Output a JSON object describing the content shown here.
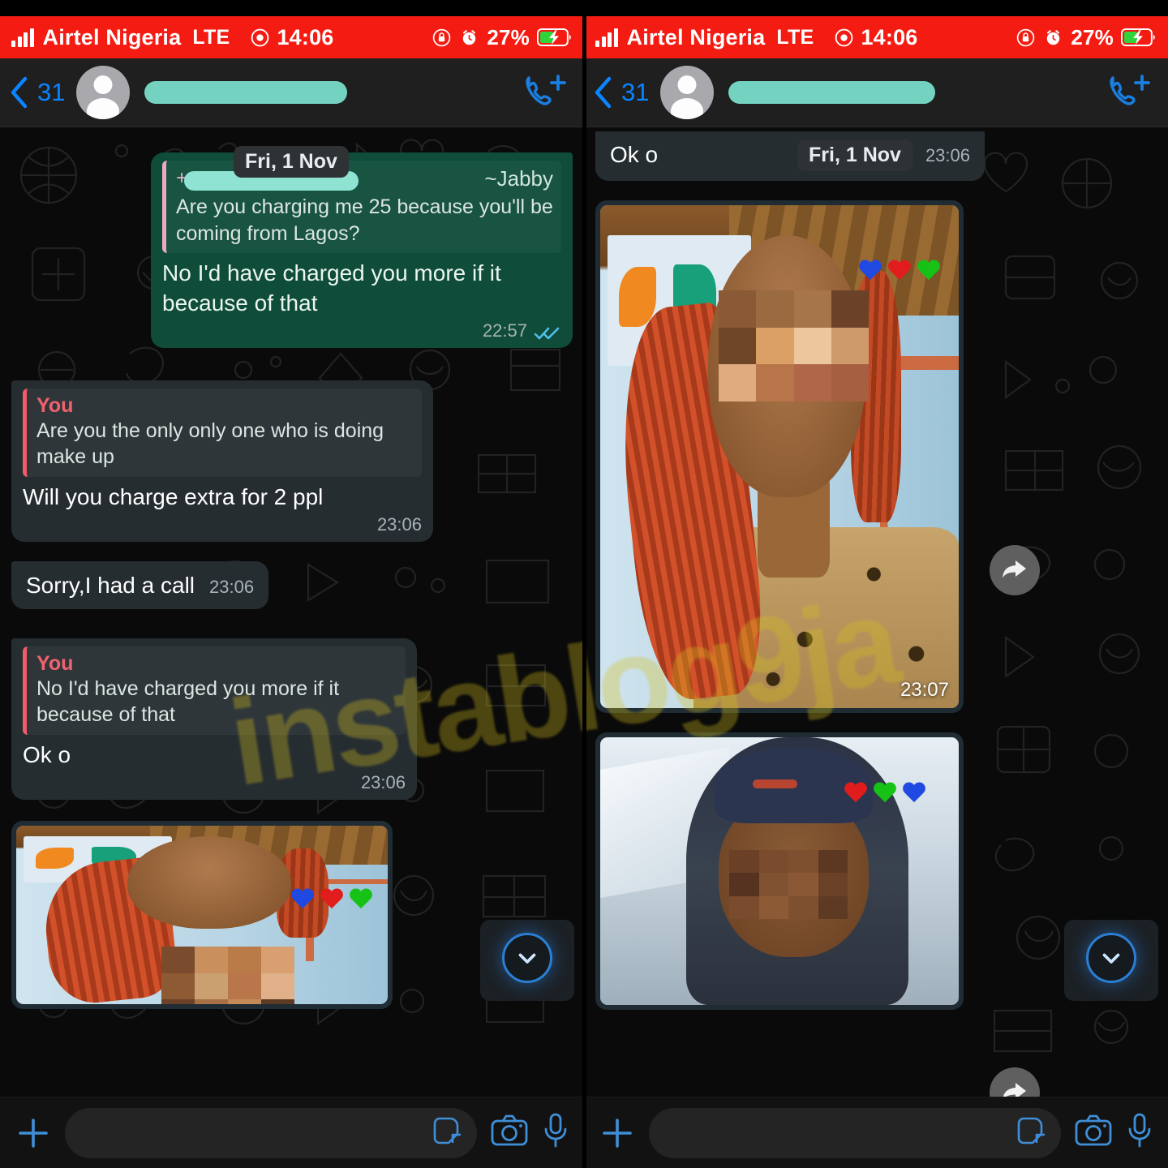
{
  "status_bar": {
    "carrier": "Airtel Nigeria",
    "network": "LTE",
    "time": "14:06",
    "battery_percent": "27%",
    "icons": [
      "signal-bars-icon",
      "location-icon",
      "rotation-lock-icon",
      "alarm-clock-icon",
      "battery-charging-icon"
    ]
  },
  "chat_header": {
    "back_label": "31",
    "contact_name_redacted": "",
    "icons": [
      "back-chevron-icon",
      "contact-avatar-icon",
      "video-call-add-icon"
    ]
  },
  "left_panel": {
    "date_chip": "Fri, 1 Nov",
    "messages": [
      {
        "id": "msg-outgoing-quote",
        "direction": "out",
        "quote": {
          "author_redacted": "+",
          "author_suffix": "~Jabby",
          "accent": "pink",
          "text": "Are you charging me 25 because you'll be coming from Lagos?"
        },
        "text": "No I'd have charged you more if it because of that",
        "time": "22:57",
        "status": "read-ticks"
      },
      {
        "id": "msg-incoming-quote-1",
        "direction": "in",
        "quote": {
          "author": "You",
          "accent": "red",
          "text": "Are you the only only one who is doing make up"
        },
        "text": "Will you charge extra for 2 ppl",
        "time": "23:06"
      },
      {
        "id": "msg-incoming-sorry",
        "direction": "in",
        "text": "Sorry,I had a call",
        "time": "23:06"
      },
      {
        "id": "msg-incoming-quote-2",
        "direction": "in",
        "quote": {
          "author": "You",
          "accent": "red",
          "text": "No I'd have charged you more if it because of that"
        },
        "text": "Ok o",
        "time": "23:06"
      },
      {
        "id": "msg-incoming-photo-partial",
        "direction": "in",
        "type": "photo",
        "reactions": [
          "blue-heart",
          "red-heart",
          "green-heart"
        ]
      }
    ]
  },
  "right_panel": {
    "date_chip": "Fri, 1 Nov",
    "messages": [
      {
        "id": "msg-incoming-oko",
        "direction": "in",
        "text": "Ok o",
        "time": "23:06"
      },
      {
        "id": "msg-incoming-photo-1",
        "direction": "in",
        "type": "photo",
        "time": "23:07",
        "reactions": [
          "blue-heart",
          "red-heart",
          "green-heart"
        ]
      },
      {
        "id": "msg-incoming-photo-2",
        "direction": "in",
        "type": "photo",
        "reactions": [
          "red-heart",
          "green-heart",
          "blue-heart"
        ]
      }
    ]
  },
  "buttons": {
    "scroll_to_bottom": "chevron-down-icon",
    "forward": "forward-arrow-icon"
  },
  "input_bar": {
    "placeholder": "",
    "icons": [
      "plus-icon",
      "sticker-icon",
      "camera-icon",
      "microphone-icon"
    ]
  },
  "watermark": {
    "text": "instablog9ja"
  },
  "colors": {
    "status_bar_red": "#f41b12",
    "accent_blue": "#0a84ff",
    "outgoing_bubble_green": "#0f4c3a",
    "incoming_bubble_grey": "#262d31",
    "redaction_teal": "#74d3c0",
    "quote_red": "#f1626f",
    "quote_pink": "#f0a8c0",
    "watermark_yellow": "#d6c01a"
  }
}
